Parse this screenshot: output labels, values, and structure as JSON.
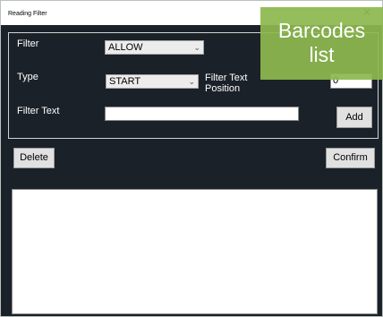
{
  "window": {
    "title": "Reading Filter",
    "close_glyph": "✕"
  },
  "filter": {
    "label": "Filter",
    "value": "ALLOW"
  },
  "type": {
    "label": "Type",
    "value": "START"
  },
  "position": {
    "label_line1": "Filter Text",
    "label_line2": "Position",
    "value": "0"
  },
  "filter_text": {
    "label": "Filter Text",
    "value": ""
  },
  "buttons": {
    "add": "Add",
    "delete": "Delete",
    "confirm": "Confirm"
  },
  "overlay": {
    "line1": "Barcodes",
    "line2": "list"
  },
  "icons": {
    "chevron": "chevron-down-icon",
    "close": "close-icon"
  },
  "colors": {
    "background": "#1b2129",
    "accent": "#8db84f"
  }
}
